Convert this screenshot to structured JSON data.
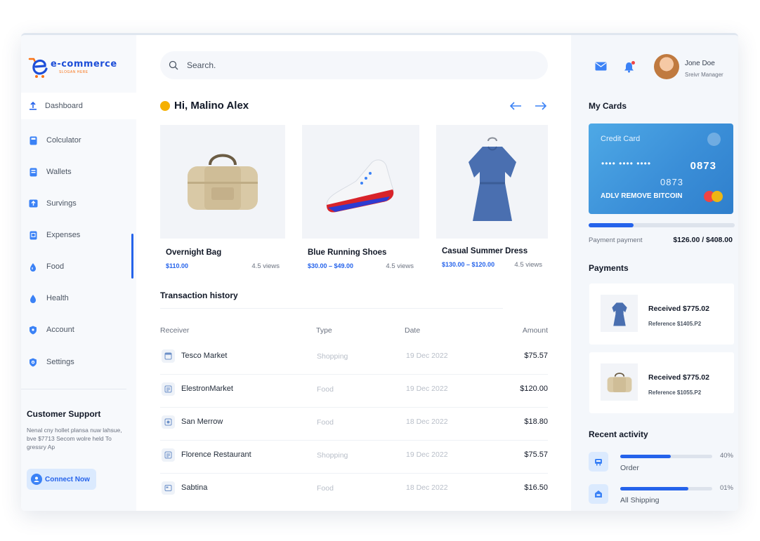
{
  "brand": {
    "name": "e-commerce",
    "tagline": "SLOGAN HERE"
  },
  "sidebar": {
    "items": [
      {
        "label": "Dashboard",
        "icon": "upload-icon"
      },
      {
        "label": "Colculator",
        "icon": "calculator-icon"
      },
      {
        "label": "Wallets",
        "icon": "wallet-icon"
      },
      {
        "label": "Survings",
        "icon": "savings-icon"
      },
      {
        "label": "Expenses",
        "icon": "expenses-icon"
      },
      {
        "label": "Food",
        "icon": "drop-icon"
      },
      {
        "label": "Health",
        "icon": "drop-icon"
      },
      {
        "label": "Account",
        "icon": "shield-icon"
      },
      {
        "label": "Settings",
        "icon": "settings-icon"
      }
    ],
    "support": {
      "title": "Customer Support",
      "text": "Nenal cny hollet plansa nuw lahsue, bve $7713 Secom wolre held To gressry Ap",
      "button": "Connect Now"
    }
  },
  "search": {
    "placeholder": "Search."
  },
  "greeting": "Hi, Malino Alex",
  "products": [
    {
      "name": "Overnight Bag",
      "price": "$110.00",
      "views": "4.5 views"
    },
    {
      "name": "Blue Running Shoes",
      "price": "$30.00 – $49.00",
      "views": "4.5 views"
    },
    {
      "name": "Casual Summer Dress",
      "price": "$130.00 – $120.00",
      "views": "4.5 views"
    }
  ],
  "transactions": {
    "title": "Transaction history",
    "headers": {
      "receiver": "Receiver",
      "type": "Type",
      "date": "Date",
      "amount": "Amount"
    },
    "rows": [
      {
        "receiver": "Tesco Market",
        "type": "Shopping",
        "date": "19 Dec 2022",
        "amount": "$75.57"
      },
      {
        "receiver": "ElestronMarket",
        "type": "Food",
        "date": "19 Dec 2022",
        "amount": "$120.00"
      },
      {
        "receiver": "San Merrow",
        "type": "Food",
        "date": "18 Dec 2022",
        "amount": "$18.80"
      },
      {
        "receiver": "Florence Restaurant",
        "type": "Shopping",
        "date": "19 Dec 2022",
        "amount": "$75.57"
      },
      {
        "receiver": "Sabtina",
        "type": "Food",
        "date": "18 Dec 2022",
        "amount": "$16.50"
      }
    ]
  },
  "user": {
    "name": "Jone Doe",
    "role": "Sreivr Manager"
  },
  "cards": {
    "title": "My Cards",
    "card_title": "Credit Card",
    "masked": "•••• •••• ••••",
    "last4": "0873",
    "number_small": "0873",
    "holder": "ADLV REMOVE BITCOIN",
    "payment_label": "Payment payment",
    "payment_amount": "$126.00 / $408.00",
    "payment_progress": 0.31
  },
  "payments": {
    "title": "Payments",
    "items": [
      {
        "received": "Received $775.02",
        "reference": "Reference $1405.P2"
      },
      {
        "received": "Received $775.02",
        "reference": "Reference $1055.P2"
      }
    ]
  },
  "activity": {
    "title": "Recent activity",
    "items": [
      {
        "label": "Order",
        "percent": "40%",
        "progress": 0.55
      },
      {
        "label": "All Shipping",
        "percent": "01%",
        "progress": 0.74
      }
    ]
  },
  "colors": {
    "accent": "#2563eb",
    "card": "#3b8fd8"
  }
}
